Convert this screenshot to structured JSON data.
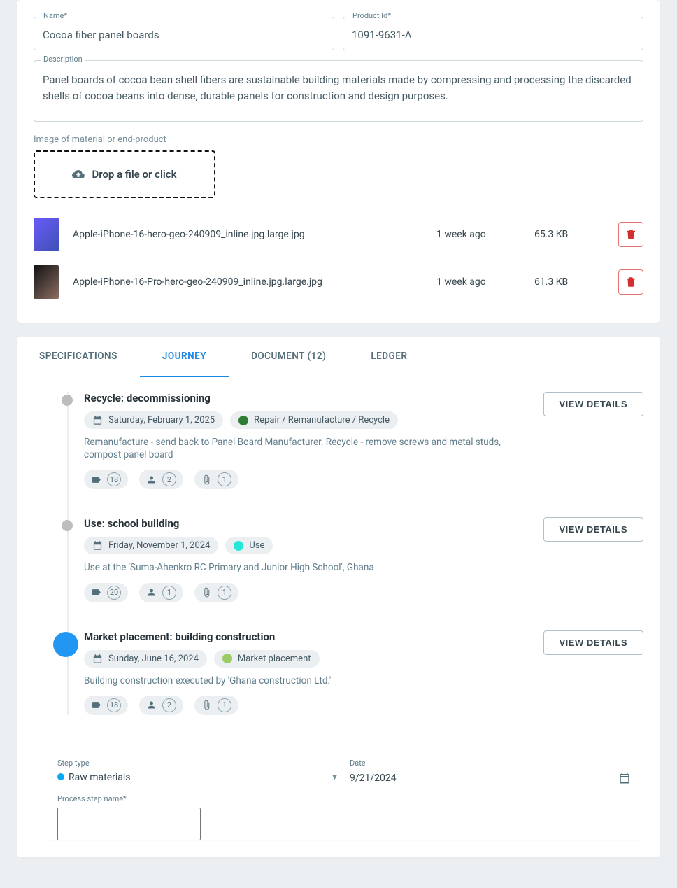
{
  "form": {
    "name_label": "Name*",
    "name_value": "Cocoa fiber panel boards",
    "productid_label": "Product Id*",
    "productid_value": "1091-9631-A",
    "description_label": "Description",
    "description_value": "Panel boards of cocoa bean shell fibers are sustainable building materials made by compressing and processing the discarded shells of cocoa beans into dense, durable panels for construction and design purposes.",
    "image_section_label": "Image of material or end-product",
    "dropzone_label": "Drop a file or click"
  },
  "files": [
    {
      "name": "Apple-iPhone-16-hero-geo-240909_inline.jpg.large.jpg",
      "when": "1 week ago",
      "size": "65.3 KB",
      "thumbclass": "gradient-blue"
    },
    {
      "name": "Apple-iPhone-16-Pro-hero-geo-240909_inline.jpg.large.jpg",
      "when": "1 week ago",
      "size": "61.3 KB",
      "thumbclass": "gradient-gold"
    }
  ],
  "tabs": {
    "spec": "SPECIFICATIONS",
    "journey": "JOURNEY",
    "document": "DOCUMENT (12)",
    "ledger": "LEDGER"
  },
  "journey": [
    {
      "title": "Recycle: decommissioning",
      "date": "Saturday, February 1, 2025",
      "status_label": "Repair / Remanufacture / Recycle",
      "status_color": "#2e7d32",
      "desc": "Remanufacture - send back to Panel Board Manufacturer. Recycle - remove screws and metal studs, compost panel board",
      "tags": 18,
      "people": 2,
      "attach": 1,
      "active": false
    },
    {
      "title": "Use: school building",
      "date": "Friday, November 1, 2024",
      "status_label": "Use",
      "status_color": "#26e6d7",
      "desc": "Use at the 'Suma-Ahenkro RC Primary and Junior High School', Ghana",
      "tags": 20,
      "people": 1,
      "attach": 1,
      "active": false
    },
    {
      "title": "Market placement: building construction",
      "date": "Sunday, June 16, 2024",
      "status_label": "Market placement",
      "status_color": "#9ccc65",
      "desc": "Building construction executed by 'Ghana construction Ltd.'",
      "tags": 18,
      "people": 2,
      "attach": 1,
      "active": true
    }
  ],
  "detail_btn": "VIEW DETAILS",
  "newstep": {
    "step_type_label": "Step type",
    "step_type_value": "Raw materials",
    "date_label": "Date",
    "date_value": "9/21/2024",
    "name_label": "Process step name*",
    "name_value": ""
  }
}
